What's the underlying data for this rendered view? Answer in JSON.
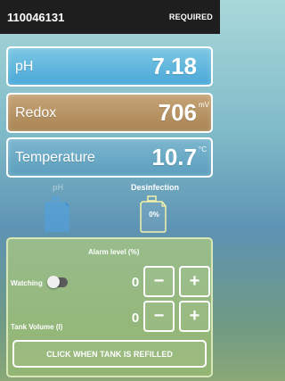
{
  "header": {
    "device_id": "110046131",
    "status": "REQUIRED"
  },
  "readings": {
    "ph": {
      "label": "pH",
      "value": "7.18",
      "unit": ""
    },
    "redox": {
      "label": "Redox",
      "value": "706",
      "unit": "mV"
    },
    "temperature": {
      "label": "Temperature",
      "value": "10.7",
      "unit": "°C"
    }
  },
  "tanks": {
    "ph": {
      "label": "pH",
      "level": ""
    },
    "disinfection": {
      "label": "Desinfection",
      "level": "0%"
    }
  },
  "panel": {
    "alarm_title": "Alarm level (%)",
    "watching_label": "Watching",
    "watching_on": false,
    "tank_volume_label": "Tank Volume (l)",
    "alarm_value": "0",
    "tank_value": "0",
    "minus": "−",
    "plus": "+",
    "refill_button": "CLICK WHEN TANK IS REFILLED"
  },
  "icons": {
    "tank": "jerrycan-icon"
  }
}
